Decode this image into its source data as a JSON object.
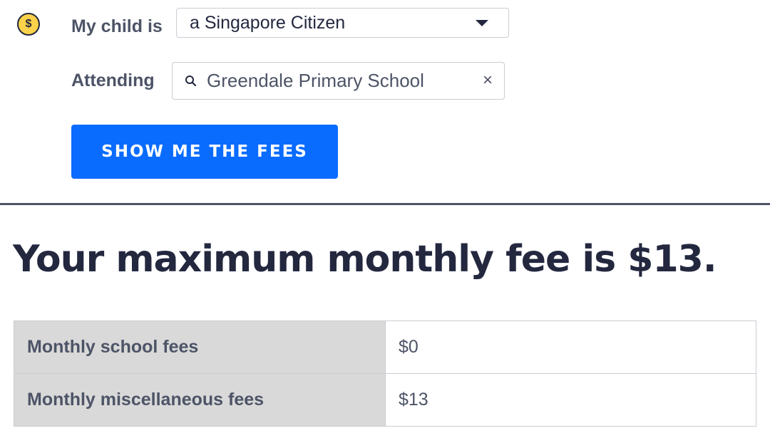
{
  "form": {
    "child_label": "My child is",
    "citizenship_selected": "a Singapore Citizen",
    "attending_label": "Attending",
    "school_value": "Greendale Primary School",
    "clear_symbol": "×",
    "submit_label": "SHOW ME THE FEES"
  },
  "icons": {
    "dollar": "$",
    "dollar_icon_name": "dollar-coin-icon",
    "search_icon_name": "search-icon",
    "caret_icon_name": "chevron-down-icon",
    "clear_icon_name": "close-icon"
  },
  "result": {
    "heading": "Your maximum monthly fee is $13.",
    "rows": [
      {
        "label": "Monthly school fees",
        "value": "$0"
      },
      {
        "label": "Monthly miscellaneous fees",
        "value": "$13"
      }
    ]
  },
  "colors": {
    "accent": "#0a6cff",
    "coin": "#fcd24a",
    "text_dark": "#23283f",
    "text_muted": "#4d5467",
    "table_label_bg": "#d9d9d9"
  }
}
